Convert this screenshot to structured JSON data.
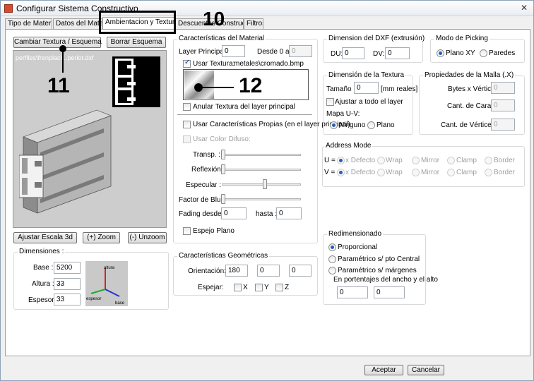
{
  "window": {
    "title": "Configurar Sistema Constructivo",
    "close": "✕"
  },
  "tabs": [
    "Tipo de Material",
    "Datos del Material",
    "Ambientacion y Texturas",
    "Descuentos Constructivos",
    "Filtros"
  ],
  "left": {
    "change_texture": "Cambiar Textura / Esquema",
    "delete_scheme": "Borrar Esquema",
    "preview_path": "perfiles\\frenplac\\...perior.dxf",
    "adjust_scale": "Ajustar Escala 3d",
    "zoom_in": "(+) Zoom",
    "zoom_out": "(-) Unzoom",
    "dimensions": {
      "title": "Dimensiones :",
      "base_label": "Base :",
      "base_value": "5200",
      "height_label": "Altura :",
      "height_value": "33",
      "thickness_label": "Espesor:",
      "thickness_value": "33",
      "axis_height": "altura",
      "axis_thickness": "espesor",
      "axis_base": "base"
    }
  },
  "material": {
    "title": "Características del Material",
    "principal_label": "Layer Principal :",
    "principal_value": "0",
    "from_label": "Desde 0 a",
    "from_value": "0",
    "use_texture_label": "Usar Textura:",
    "texture_path": "metales\\cromado.bmp",
    "override_label": "Anular Textura del layer principal",
    "own_props_label": "Usar Características Propias (en el layer principal)",
    "use_diffuse_label": "Usar Color Difuso:",
    "sliders": {
      "transparency": "Transp. :",
      "reflection": "Reflexión:",
      "specular": "Especular :",
      "blur": "Factor de Blur:",
      "transparency_level": 0,
      "reflection_level": 0,
      "specular_level": 0.55,
      "blur_level": 0
    },
    "fading_label": "Fading desde:",
    "fading_from": "0",
    "fading_to_label": "hasta :",
    "fading_to": "0",
    "mirror_label": "Espejo Plano"
  },
  "geometric": {
    "title": "Características Geométricas",
    "orientation_label": "Orientación:",
    "orientation_values": [
      "180",
      "0",
      "0"
    ],
    "mirror_label": "Espejar:",
    "axes": [
      "X",
      "Y",
      "Z"
    ]
  },
  "dxf": {
    "title": "Dimension del DXF (extrusión)",
    "du_label": "DU:",
    "du_value": "0",
    "dv_label": "DV:",
    "dv_value": "0"
  },
  "picking": {
    "title": "Modo de Picking",
    "options": [
      "Plano XY",
      "Paredes"
    ]
  },
  "texture_dim": {
    "title": "Dimensión de la Textura",
    "size_label": "Tamaño :",
    "size_value": "0",
    "size_unit": "[mm reales]",
    "fit_label": "Ajustar a todo el layer",
    "uv_label": "Mapa U-V:",
    "uv_options": [
      "Ninguno",
      "Plano"
    ]
  },
  "mesh": {
    "title": "Propiedades de la Malla (.X)",
    "bytes_label": "Bytes x Vértice:",
    "bytes_value": "0",
    "faces_label": "Cant. de Caras:",
    "faces_value": "0",
    "vertices_label": "Cant. de Vértices:",
    "vertices_value": "0"
  },
  "address": {
    "title": "Address Mode",
    "u_label": "U =",
    "v_label": "V =",
    "options": [
      "x Defecto",
      "Wrap",
      "Mirror",
      "Clamp",
      "Border"
    ]
  },
  "resize": {
    "title": "Redimensionado",
    "options": [
      "Proporcional",
      "Paramétrico s/ pto Central",
      "Paramétrico s/ márgenes"
    ],
    "note": "En portentajes del ancho y el alto",
    "value1": "0",
    "value2": "0"
  },
  "footer": {
    "accept": "Aceptar",
    "cancel": "Cancelar"
  },
  "annotations": {
    "a10": "10",
    "a11": "11",
    "a12": "12"
  }
}
